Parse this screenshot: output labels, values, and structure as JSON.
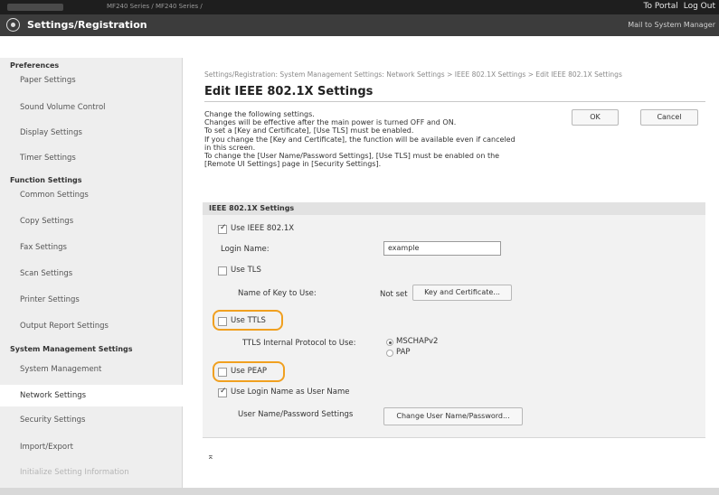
{
  "topbar": {
    "model": "MF240 Series / MF240 Series /",
    "portal_link": "To Portal",
    "logout_link": "Log Out"
  },
  "titlebar": {
    "title": "Settings/Registration",
    "mailto": "Mail to System Manager"
  },
  "sidebar": {
    "preferences_head": "Preferences",
    "paper_settings": "Paper Settings",
    "sound_volume": "Sound Volume Control",
    "display_settings": "Display Settings",
    "timer_settings": "Timer Settings",
    "function_head": "Function Settings",
    "common_settings": "Common Settings",
    "copy_settings": "Copy Settings",
    "fax_settings": "Fax Settings",
    "scan_settings": "Scan Settings",
    "printer_settings": "Printer Settings",
    "output_report": "Output Report Settings",
    "system_head": "System Management Settings",
    "system_management": "System Management",
    "network_settings": "Network Settings",
    "security_settings": "Security Settings",
    "import_export": "Import/Export",
    "initialize": "Initialize Setting Information"
  },
  "main": {
    "breadcrumb": "Settings/Registration: System Management Settings: Network Settings > IEEE 802.1X Settings > Edit IEEE 802.1X Settings",
    "title": "Edit IEEE 802.1X Settings",
    "desc1": "Change the following settings.",
    "desc2": "Changes will be effective after the main power is turned OFF and ON.",
    "desc3": "To set a [Key and Certificate], [Use TLS] must be enabled.",
    "desc4": "If you change the [Key and Certificate], the function will be available even if canceled",
    "desc5": "in this screen.",
    "desc6": "To change the [User Name/Password Settings], [Use TLS] must be enabled on the",
    "desc7": "[Remote UI Settings] page in [Security Settings].",
    "ok_button": "OK",
    "cancel_button": "Cancel"
  },
  "panel": {
    "heading": "IEEE 802.1X Settings",
    "use_ieee": "Use IEEE 802.1X",
    "login_name_label": "Login Name:",
    "login_name_value": "example",
    "use_tls": "Use TLS",
    "key_name_label": "Name of Key to Use:",
    "key_name_value": "Not set",
    "key_button": "Key and Certificate...",
    "use_ttls": "Use TTLS",
    "ttls_protocol_label": "TTLS Internal Protocol to Use:",
    "opt_mschap": "MSCHAPv2",
    "opt_pap": "PAP",
    "use_peap": "Use PEAP",
    "use_login_as_user": "Use Login Name as User Name",
    "userpass_label": "User Name/Password Settings",
    "userpass_button": "Change User Name/Password..."
  },
  "to_top": "⌅",
  "colors": {
    "topbar": "#1e1e1e",
    "titlebar": "#3c3c3c",
    "highlight": "#f0a020"
  }
}
